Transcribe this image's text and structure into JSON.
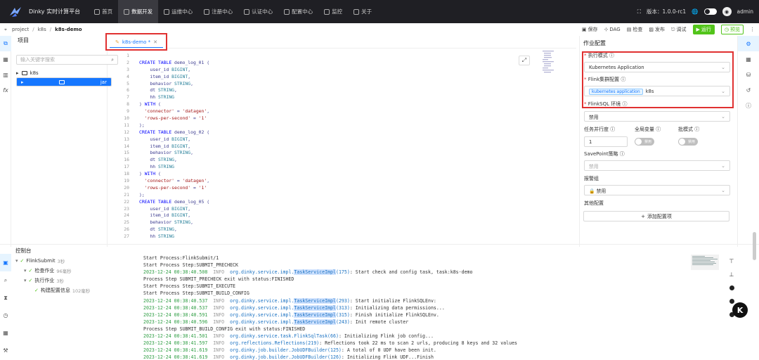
{
  "header": {
    "brand": "Dinky 实时计算平台",
    "nav": [
      {
        "label": "首页",
        "active": false
      },
      {
        "label": "数据开发",
        "active": true
      },
      {
        "label": "运维中心",
        "active": false
      },
      {
        "label": "注册中心",
        "active": false
      },
      {
        "label": "认证中心",
        "active": false
      },
      {
        "label": "配置中心",
        "active": false
      },
      {
        "label": "监控",
        "active": false
      },
      {
        "label": "关于",
        "active": false
      }
    ],
    "version": "版本：1.0.0-rc1",
    "user": "admin"
  },
  "breadcrumb": [
    "project",
    "k8s",
    "k8s-demo"
  ],
  "toolbar": {
    "save": "保存",
    "dag": "DAG",
    "check": "检查",
    "publish": "发布",
    "debug": "调试",
    "run": "运行",
    "preview": "预览"
  },
  "project": {
    "title": "项目",
    "search_placeholder": "输入关键字搜索",
    "tree": [
      {
        "label": "k8s",
        "selected": false
      },
      {
        "label": "jar",
        "selected": true
      },
      {
        "label": "sql",
        "selected": false
      }
    ]
  },
  "tab": {
    "label": "k8s-demo *"
  },
  "code": [
    {
      "n": "1",
      "t": ""
    },
    {
      "n": "2",
      "t": "CREATE TABLE demo_log_01 ("
    },
    {
      "n": "3",
      "t": "    user_id BIGINT,"
    },
    {
      "n": "4",
      "t": "    item_id BIGINT,"
    },
    {
      "n": "5",
      "t": "    behavior STRING,"
    },
    {
      "n": "6",
      "t": "    dt STRING,"
    },
    {
      "n": "7",
      "t": "    hh STRING"
    },
    {
      "n": "8",
      "t": ") WITH ("
    },
    {
      "n": "9",
      "t": "  'connector' = 'datagen',"
    },
    {
      "n": "10",
      "t": "  'rows-per-second' = '1'"
    },
    {
      "n": "11",
      "t": ");"
    },
    {
      "n": "12",
      "t": "CREATE TABLE demo_log_02 ("
    },
    {
      "n": "13",
      "t": "    user_id BIGINT,"
    },
    {
      "n": "14",
      "t": "    item_id BIGINT,"
    },
    {
      "n": "15",
      "t": "    behavior STRING,"
    },
    {
      "n": "16",
      "t": "    dt STRING,"
    },
    {
      "n": "17",
      "t": "    hh STRING"
    },
    {
      "n": "18",
      "t": ") WITH ("
    },
    {
      "n": "19",
      "t": "  'connector' = 'datagen',"
    },
    {
      "n": "20",
      "t": "  'rows-per-second' = '1'"
    },
    {
      "n": "21",
      "t": ");"
    },
    {
      "n": "22",
      "t": "CREATE TABLE demo_log_05 ("
    },
    {
      "n": "23",
      "t": "    user_id BIGINT,"
    },
    {
      "n": "24",
      "t": "    item_id BIGINT,"
    },
    {
      "n": "25",
      "t": "    behavior STRING,"
    },
    {
      "n": "26",
      "t": "    dt STRING,"
    },
    {
      "n": "27",
      "t": "    hh STRING"
    },
    {
      "n": "28",
      "t": ") WITH ("
    }
  ],
  "config": {
    "title": "作业配置",
    "exec_mode_label": "执行模式",
    "exec_mode_value": "Kubernetes Application",
    "cluster_label": "Flink集群配置",
    "cluster_tag": "kubernetes application",
    "cluster_value": "k8s",
    "env_label": "FlinkSQL 环境",
    "env_value": "禁用",
    "parallel_label": "任务并行度",
    "parallel_value": "1",
    "global_var_label": "全局变量",
    "global_var_state": "禁用",
    "batch_label": "批模式",
    "batch_state": "禁用",
    "savepoint_label": "SavePoint策略",
    "savepoint_value": "禁用",
    "alert_label": "报警组",
    "alert_value": "禁用",
    "other_label": "其他配置",
    "add_config": "添加配置项"
  },
  "console": {
    "title": "控制台",
    "steps": [
      {
        "label": "FlinkSubmit",
        "dur": "3秒",
        "level": 0
      },
      {
        "label": "检查作业",
        "dur": "96毫秒",
        "level": 1
      },
      {
        "label": "执行作业",
        "dur": "3秒",
        "level": 1
      },
      {
        "label": "构建配置信息",
        "dur": "102毫秒",
        "level": 2
      }
    ],
    "logs": [
      {
        "p": "",
        "ts": "",
        "lv": "",
        "cls": "",
        "m": "Start Process:FlinkSubmit/1"
      },
      {
        "p": "",
        "ts": "",
        "lv": "",
        "cls": "",
        "m": "Start Process Step:SUBMIT_PRECHECK"
      },
      {
        "p": "",
        "ts": "2023-12-24 00:38:40.508",
        "lv": "INFO",
        "cls": "org.dinky.service.impl.TaskServiceImpl(175)",
        "m": ": Start check and config task, task:k8s-demo"
      },
      {
        "p": "",
        "ts": "",
        "lv": "",
        "cls": "",
        "m": "Process Step SUBMIT_PRECHECK exit with status:FINISHED"
      },
      {
        "p": "",
        "ts": "",
        "lv": "",
        "cls": "",
        "m": "Start Process Step:SUBMIT_EXECUTE"
      },
      {
        "p": "",
        "ts": "",
        "lv": "",
        "cls": "",
        "m": "Start Process Step:SUBMIT_BUILD_CONFIG"
      },
      {
        "p": "",
        "ts": "2023-12-24 00:38:40.537",
        "lv": "INFO",
        "cls": "org.dinky.service.impl.TaskServiceImpl(293)",
        "m": ": Start initialize FlinkSQLEnv:"
      },
      {
        "p": "",
        "ts": "2023-12-24 00:38:40.537",
        "lv": "INFO",
        "cls": "org.dinky.service.impl.TaskServiceImpl(313)",
        "m": ": Initializing data permissions..."
      },
      {
        "p": "",
        "ts": "2023-12-24 00:38:40.591",
        "lv": "INFO",
        "cls": "org.dinky.service.impl.TaskServiceImpl(315)",
        "m": ": Finish initialize FlinkSQLEnv."
      },
      {
        "p": "",
        "ts": "2023-12-24 00:38:40.596",
        "lv": "INFO",
        "cls": "org.dinky.service.impl.TaskServiceImpl(243)",
        "m": ": Init remote cluster"
      },
      {
        "p": "",
        "ts": "",
        "lv": "",
        "cls": "",
        "m": "Process Step SUBMIT_BUILD_CONFIG exit with status:FINISHED"
      },
      {
        "p": "",
        "ts": "2023-12-24 00:38:41.501",
        "lv": "INFO",
        "cls": "org.dinky.service.task.FlinkSqlTask(66)",
        "m": ": Initializing Flink job config..."
      },
      {
        "p": "",
        "ts": "2023-12-24 00:38:41.597",
        "lv": "INFO",
        "cls": "org.reflections.Reflections(219)",
        "m": ": Reflections took 22 ms to scan 2 urls, producing 8 keys and 32 values"
      },
      {
        "p": "",
        "ts": "2023-12-24 00:38:41.619",
        "lv": "INFO",
        "cls": "org.dinky.job.builder.JobUDFBuilder(125)",
        "m": ": A total of 0 UDF have been init."
      },
      {
        "p": "",
        "ts": "2023-12-24 00:38:41.619",
        "lv": "INFO",
        "cls": "org.dinky.job.builder.JobUDFBuilder(126)",
        "m": ": Initializing Flink UDF...Finish"
      }
    ]
  }
}
